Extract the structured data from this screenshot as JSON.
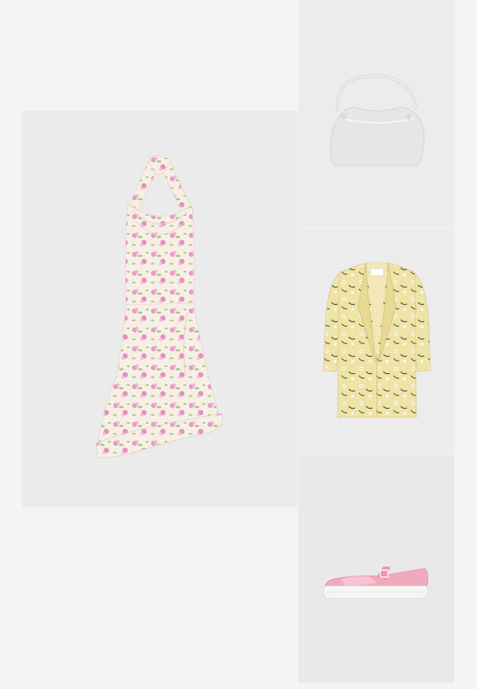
{
  "outfit": {
    "items": [
      {
        "id": "dress",
        "icon": "floral-halter-dress-image"
      },
      {
        "id": "bag",
        "icon": "white-shoulder-bag-image"
      },
      {
        "id": "blazer",
        "icon": "yellow-floral-blazer-image"
      },
      {
        "id": "shoes",
        "icon": "pink-mary-jane-sneaker-image"
      }
    ]
  },
  "colors": {
    "page_background": "#f4f4f4",
    "tile_background": "#ebebeb",
    "dress_base": "#f6f0e4",
    "dress_print_pink": "#e79ac9",
    "dress_print_green": "#a9c08b",
    "bag": "#e6e6e6",
    "blazer": "#efe3a6",
    "shoe_pink": "#f3a9bd"
  }
}
